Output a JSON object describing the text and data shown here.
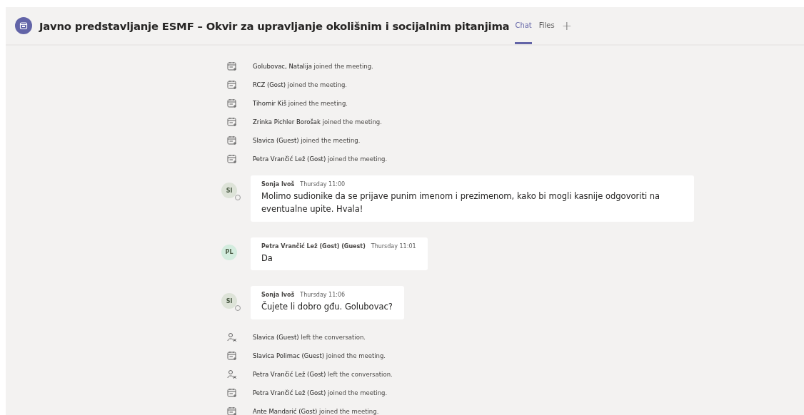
{
  "header": {
    "title": "Javno predstavljanje ESMF – Okvir za upravljanje okolišnim i socijalnim pitanjima",
    "tabs": [
      {
        "label": "Chat",
        "selected": true
      },
      {
        "label": "Files",
        "selected": false
      }
    ],
    "add_tab": "+"
  },
  "feed": [
    {
      "kind": "joined",
      "text": "**Golubovac, Natalija** joined the meeting."
    },
    {
      "kind": "joined",
      "text": "**RCZ (Gost)** joined the meeting."
    },
    {
      "kind": "joined",
      "text": "**Tihomir Kiš** joined the meeting."
    },
    {
      "kind": "joined",
      "text": "**Zrinka Pichler Borošak** joined the meeting."
    },
    {
      "kind": "joined",
      "text": "**Slavica (Guest)** joined the meeting."
    },
    {
      "kind": "joined",
      "text": "**Petra Vrančić Lež (Gost)** joined the meeting."
    },
    {
      "kind": "message",
      "initials": "SI",
      "status_badge": true,
      "color": "#dde3d8",
      "author": "Sonja Ivoš",
      "time": "Thursday 11:00",
      "body": "Molimo sudionike da se prijave punim imenom i prezimenom, kako bi mogli kasnije odgovoriti na eventualne upite. Hvala!"
    },
    {
      "kind": "message",
      "initials": "PL",
      "status_badge": false,
      "color": "#d3ecde",
      "author": "Petra Vrančić Lež (Gost) (Guest)",
      "time": "Thursday 11:01",
      "body": "Da"
    },
    {
      "kind": "message",
      "initials": "SI",
      "status_badge": true,
      "color": "#dde3d8",
      "author": "Sonja Ivoš",
      "time": "Thursday 11:06",
      "body": "Čujete li dobro gđu. Golubovac?"
    },
    {
      "kind": "left",
      "text": "**Slavica (Guest)** left the conversation."
    },
    {
      "kind": "joined",
      "text": "**Slavica Polimac (Guest)** joined the meeting."
    },
    {
      "kind": "left",
      "text": "**Petra Vrančić Lež (Gost)** left the conversation."
    },
    {
      "kind": "joined",
      "text": "**Petra Vrančić Lež (Gost)** joined the meeting."
    },
    {
      "kind": "joined",
      "text": "**Ante Mandarić (Gost)** joined the meeting."
    }
  ]
}
